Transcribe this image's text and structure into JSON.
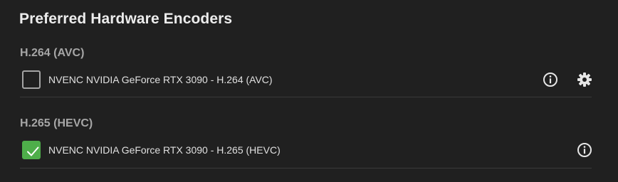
{
  "page": {
    "title": "Preferred Hardware Encoders"
  },
  "sections": [
    {
      "title": "H.264 (AVC)",
      "encoder": {
        "label": "NVENC NVIDIA GeForce RTX 3090 - H.264 (AVC)",
        "checked": false,
        "icons": [
          "info-icon",
          "gear-icon"
        ]
      }
    },
    {
      "title": "H.265 (HEVC)",
      "encoder": {
        "label": "NVENC NVIDIA GeForce RTX 3090 - H.265 (HEVC)",
        "checked": true,
        "icons": [
          "info-icon"
        ]
      }
    }
  ],
  "colors": {
    "background": "#202020",
    "checked": "#4eae4a",
    "text": "#e0e0e0",
    "section_title": "#a6a6a6"
  }
}
